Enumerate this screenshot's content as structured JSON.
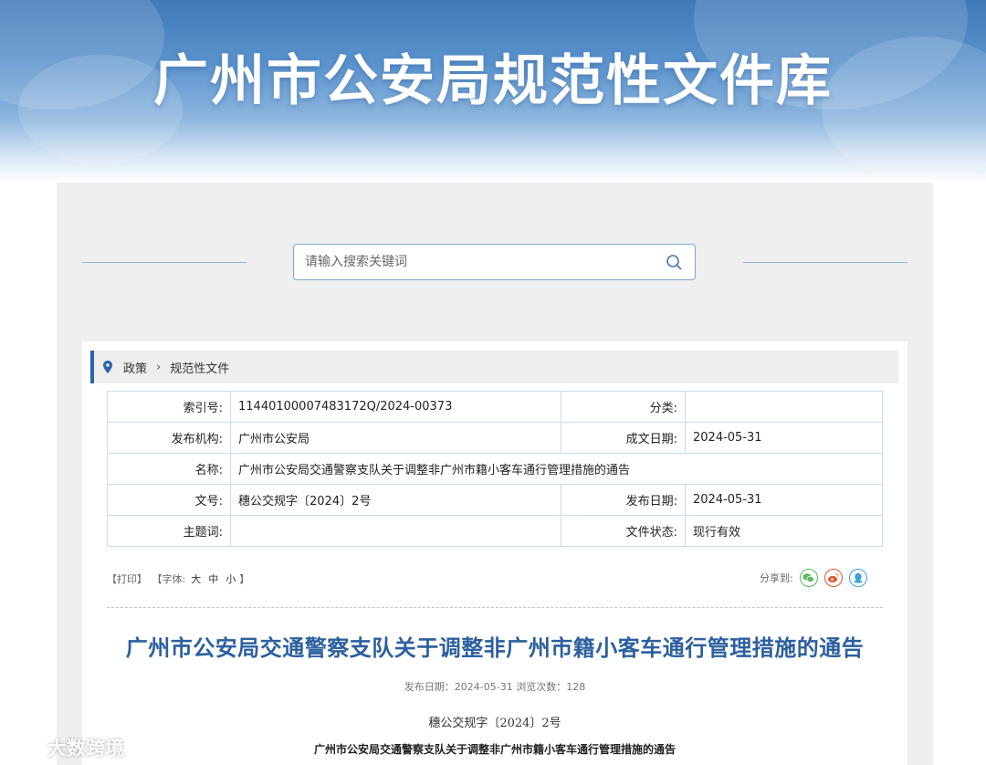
{
  "banner": {
    "title": "广州市公安局规范性文件库"
  },
  "search": {
    "placeholder": "请输入搜索关键词",
    "icon": "search-icon"
  },
  "breadcrumb": {
    "items": [
      "政策",
      "规范性文件"
    ],
    "icon": "location-pin-icon"
  },
  "meta": {
    "index_label": "索引号:",
    "index_value": "11440100007483172Q/2024-00373",
    "category_label": "分类:",
    "category_value": "",
    "publisher_label": "发布机构:",
    "publisher_value": "广州市公安局",
    "created_label": "成文日期:",
    "created_value": "2024-05-31",
    "name_label": "名称:",
    "name_value": "广州市公安局交通警察支队关于调整非广州市籍小客车通行管理措施的通告",
    "docnum_label": "文号:",
    "docnum_value": "穗公交规字〔2024〕2号",
    "pubdate_label": "发布日期:",
    "pubdate_value": "2024-05-31",
    "keywords_label": "主题词:",
    "keywords_value": "",
    "status_label": "文件状态:",
    "status_value": "现行有效"
  },
  "tools": {
    "print": "【打印】",
    "font_prefix": "【字体:",
    "font_large": "大",
    "font_medium": "中",
    "font_small": "小",
    "font_suffix": "】",
    "share_label": "分享到:",
    "share_icons": [
      "wechat-icon",
      "weibo-icon",
      "qq-icon"
    ]
  },
  "article": {
    "title": "广州市公安局交通警察支队关于调整非广州市籍小客车通行管理措施的通告",
    "pub_info": "发布日期：2024-05-31  浏览次数：128",
    "doc_number": "穗公交规字〔2024〕2号",
    "subtitle": "广州市公安局交通警察支队关于调整非广州市籍小客车通行管理措施的通告"
  },
  "watermark": {
    "text": "大数跨境"
  },
  "colors": {
    "accent": "#2d64a8",
    "title": "#2d5f9f",
    "border": "#c9dced",
    "wechat": "#5cb85c",
    "weibo": "#e4572e",
    "qq": "#3aa0d8"
  }
}
